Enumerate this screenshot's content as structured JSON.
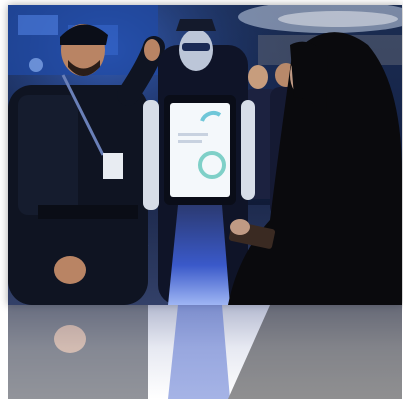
{
  "scene": {
    "subjects": [
      "police-officer",
      "humanoid-robot",
      "visitor-in-abaya"
    ]
  }
}
